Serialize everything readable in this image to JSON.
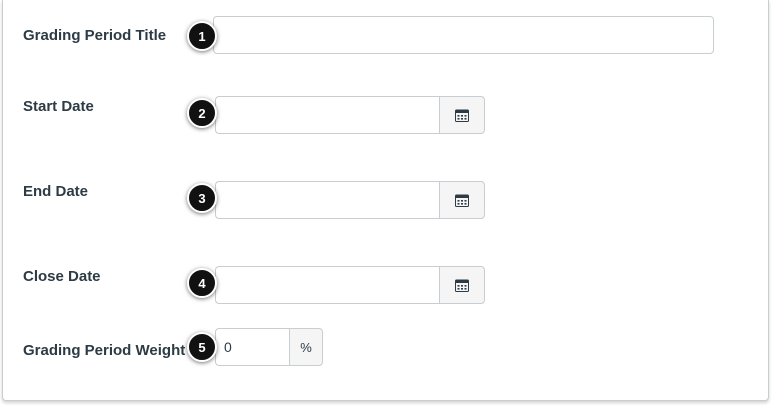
{
  "form": {
    "title": {
      "label": "Grading Period Title",
      "value": "",
      "badge": "1"
    },
    "start_date": {
      "label": "Start Date",
      "value": "",
      "badge": "2",
      "icon": "calendar-icon"
    },
    "end_date": {
      "label": "End Date",
      "value": "",
      "badge": "3",
      "icon": "calendar-icon"
    },
    "close_date": {
      "label": "Close Date",
      "value": "",
      "badge": "4",
      "icon": "calendar-icon"
    },
    "weight": {
      "label": "Grading Period Weight",
      "value": "0",
      "suffix": "%",
      "badge": "5"
    }
  },
  "colors": {
    "label_text": "#2d3b45",
    "input_border": "#c7cdd1",
    "addon_background": "#f5f5f5",
    "badge_background": "#111111"
  }
}
